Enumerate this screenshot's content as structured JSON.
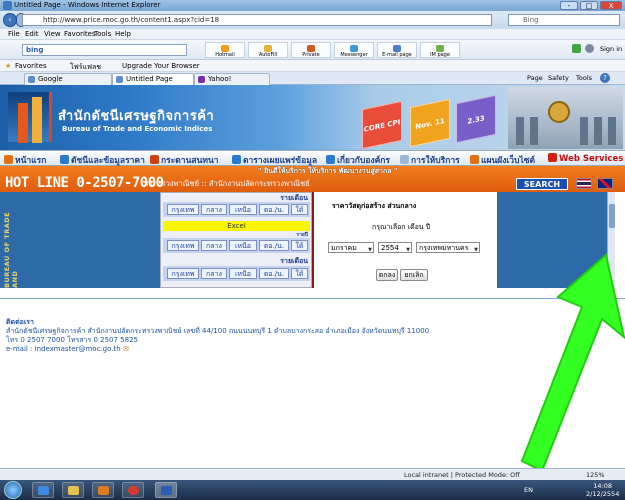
{
  "window": {
    "title": "Untitled Page - Windows Internet Explorer",
    "url": "http://www.price.moc.go.th/content1.aspx?cid=18",
    "search_engine": "bing",
    "search_value": "Bing",
    "bing_placeholder": "Bing",
    "controls": {
      "minimize": "-",
      "maximize": "□",
      "close": "X"
    }
  },
  "menu": {
    "file": "File",
    "edit": "Edit",
    "view": "View",
    "favorites": "Favorites",
    "tools": "Tools",
    "help": "Help"
  },
  "toolbar": {
    "search_brand": "bing",
    "buttons": [
      "Hotmail",
      "AutoFill",
      "Private",
      "Messenger",
      "E-mail page",
      "IM page"
    ],
    "signin": "Sign in"
  },
  "favorites_bar": {
    "favorites": "Favorites",
    "item1": "โฟร์แฟลช",
    "item2": "Upgrade Your Browser"
  },
  "tabs": [
    {
      "label": "Google",
      "active": false
    },
    {
      "label": "Untitled Page",
      "active": true
    },
    {
      "label": "Yahoo!",
      "active": false
    }
  ],
  "command_bar": {
    "page": "Page",
    "safety": "Safety",
    "tools": "Tools",
    "help": "?"
  },
  "banner": {
    "title_thai": "สำนักดัชนีเศรษฐกิจการค้า",
    "title_en": "Bureau of Trade and Economic Indices",
    "cube1": "CORE CPI",
    "cube2": "Nov. 11",
    "cube3": "2.33"
  },
  "navigation": [
    {
      "label": "หน้าแรก",
      "icon_color": "#e07010"
    },
    {
      "label": "ดัชนีและข้อมูลราคา",
      "icon_color": "#2a7ad0"
    },
    {
      "label": "กระดานสนทนา",
      "icon_color": "#d04010"
    },
    {
      "label": "ตารางเผยแพร่ข้อมูล",
      "icon_color": "#2a7ad0"
    },
    {
      "label": "เกี่ยวกับองค์กร",
      "icon_color": "#2a7ad0"
    },
    {
      "label": "การให้บริการ",
      "icon_color": "#2a7ad0"
    },
    {
      "label": "แผนผังเว็บไซต์",
      "icon_color": "#e07010"
    },
    {
      "label": "Web Services",
      "icon_color": "#d02010"
    }
  ],
  "hotline": {
    "text": "HOT LINE 0-2507-7000",
    "marquee": "\" ยินดีให้บริการ ให้บริการ พัฒนางานสู่สากล \"",
    "ministry": "กระทรวงพาณิชย์ :: สำนักงานปลัดกระทรวงพาณิชย์",
    "search": "SEARCH"
  },
  "sidebar_label": "BUREAU OF TRADE AND",
  "center_panel": {
    "header1": "รายเดือน",
    "header2": "รายปี",
    "header3": "รายเดือน",
    "excel": "Excel",
    "regions": [
      "กรุงเทพ",
      "กลาง",
      "เหนือ",
      "ตอ./น.",
      "ใต้"
    ]
  },
  "form": {
    "title": "ราคาวัสดุก่อสร้าง ส่วนกลาง",
    "prompt": "กรุณาเลือก เดือน ปี",
    "month": "มกราคม",
    "year": "2554",
    "province": "กรุงเทพมหานคร",
    "ok_button": "ตกลง",
    "cancel_button": "ยกเลิก"
  },
  "contact": {
    "heading": "ติดต่อเรา",
    "address": "สำนักดัชนีเศรษฐกิจการค้า สำนักงานปลัดกระทรวงพาณิชย์ เลขที่ 44/100 ถนนนนทบุรี 1 ตำบลบางกระสอ อำเภอเมือง จังหวัดนนทบุรี 11000",
    "phone": "โทร 0 2507 7000 โทรสาร 0 2507 5825",
    "email": "e-mail : indexmaster@moc.go.th"
  },
  "status": {
    "zone": "Local intranet | Protected Mode: Off",
    "zoom": "125%"
  },
  "taskbar": {
    "lang": "EN",
    "time": "14:08",
    "date": "2/12/2554"
  },
  "colors": {
    "accent_orange": "#e8601a",
    "brand_blue": "#2e6aa8",
    "arrow_green": "#33ff22"
  }
}
